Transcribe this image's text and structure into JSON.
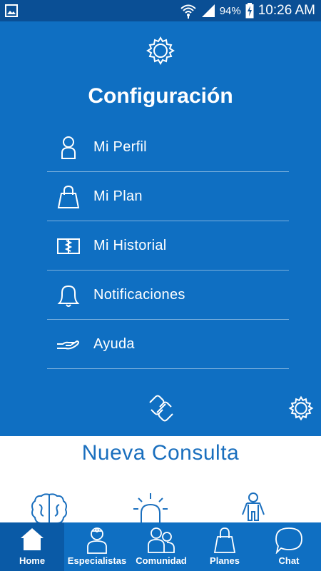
{
  "status_bar": {
    "notification_icon": "image-icon",
    "battery_percent": "94%",
    "time": "10:26 AM"
  },
  "settings": {
    "title": "Configuración",
    "items": [
      {
        "label": "Mi Perfil",
        "icon": "person-icon"
      },
      {
        "label": "Mi Plan",
        "icon": "shopping-bag-icon"
      },
      {
        "label": "Mi Historial",
        "icon": "book-icon"
      },
      {
        "label": "Notificaciones",
        "icon": "bell-icon"
      },
      {
        "label": "Ayuda",
        "icon": "helping-hand-icon"
      }
    ]
  },
  "consult": {
    "title": "Nueva Consulta",
    "categories": [
      "brain-icon",
      "emergency-light-icon",
      "child-icon"
    ]
  },
  "bottom_nav": {
    "items": [
      {
        "label": "Home",
        "icon": "home-icon",
        "active": true
      },
      {
        "label": "Especialistas",
        "icon": "doctor-icon",
        "active": false
      },
      {
        "label": "Comunidad",
        "icon": "community-icon",
        "active": false
      },
      {
        "label": "Planes",
        "icon": "bag-icon",
        "active": false
      },
      {
        "label": "Chat",
        "icon": "chat-bubble-icon",
        "active": false
      }
    ]
  },
  "colors": {
    "status_bar": "#0a4f95",
    "panel": "#0f6fc2",
    "nav_active": "#0a5aa6",
    "accent_text": "#1a6fbe"
  }
}
